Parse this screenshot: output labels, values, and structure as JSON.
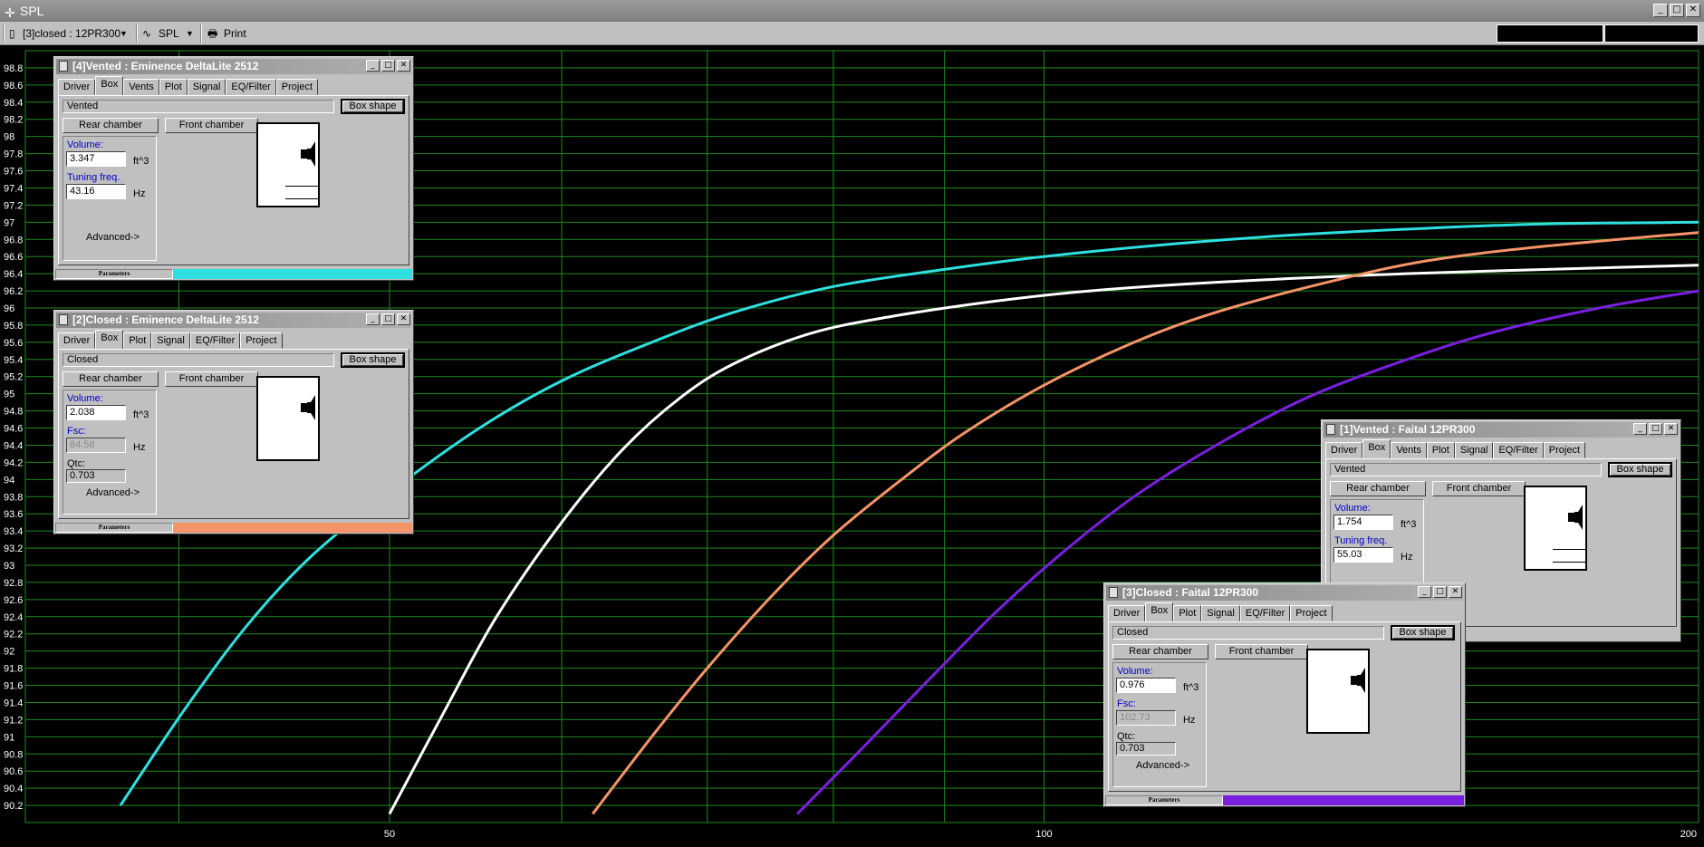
{
  "window": {
    "title": "SPL"
  },
  "toolbar": {
    "project_select": "[3]closed : 12PR300",
    "graph_select": "SPL",
    "print_label": "Print"
  },
  "colors": {
    "trace1": "#f59468",
    "trace2": "#ffffff",
    "trace3": "#7a1fe0",
    "trace4": "#30e0e0",
    "grid": "#1f8a1f"
  },
  "chart_data": {
    "type": "line",
    "title": "",
    "xlabel": "",
    "ylabel": "",
    "xscale": "log",
    "xlim": [
      34,
      200
    ],
    "ylim": [
      90.0,
      99.0
    ],
    "xticks": [
      "50",
      "100",
      "200"
    ],
    "yticks": [
      "98.8",
      "98.6",
      "98.4",
      "98.2",
      "98",
      "97.8",
      "97.6",
      "97.4",
      "97.2",
      "97",
      "96.8",
      "96.6",
      "96.4",
      "96.2",
      "96",
      "95.8",
      "95.6",
      "95.4",
      "95.2",
      "95",
      "94.8",
      "94.6",
      "94.4",
      "94.2",
      "94",
      "93.8",
      "93.6",
      "93.4",
      "93.2",
      "93",
      "92.8",
      "92.6",
      "92.4",
      "92.2",
      "92",
      "91.8",
      "91.6",
      "91.4",
      "91.2",
      "91",
      "90.8",
      "90.6",
      "90.4",
      "90.2"
    ],
    "grid": true,
    "series": [
      {
        "color": "#30e0e0",
        "x": [
          37.6,
          40.2,
          43,
          46,
          50,
          55,
          60,
          66,
          72,
          80,
          90,
          100,
          115,
          130,
          150,
          170,
          200
        ],
        "y": [
          90.2,
          91.3,
          92.3,
          93.1,
          93.85,
          94.6,
          95.15,
          95.6,
          95.95,
          96.25,
          96.45,
          96.6,
          96.75,
          96.85,
          96.93,
          96.98,
          97.0
        ]
      },
      {
        "color": "#ffffff",
        "x": [
          50,
          53,
          56,
          60,
          64,
          68,
          72,
          78,
          85,
          95,
          105,
          120,
          140,
          160,
          200
        ],
        "y": [
          90.1,
          91.3,
          92.4,
          93.5,
          94.35,
          94.95,
          95.35,
          95.7,
          95.9,
          96.08,
          96.2,
          96.3,
          96.38,
          96.43,
          96.5
        ]
      },
      {
        "color": "#f59468",
        "x": [
          62,
          66,
          70,
          75,
          80,
          86,
          92,
          100,
          110,
          120,
          135,
          150,
          170,
          200
        ],
        "y": [
          90.1,
          91.0,
          91.8,
          92.65,
          93.35,
          94.0,
          94.55,
          95.1,
          95.6,
          95.95,
          96.3,
          96.55,
          96.72,
          96.88
        ]
      },
      {
        "color": "#7a1fe0",
        "x": [
          77,
          82,
          88,
          95,
          102,
          110,
          120,
          132,
          145,
          160,
          180,
          200
        ],
        "y": [
          90.1,
          90.8,
          91.6,
          92.45,
          93.15,
          93.8,
          94.4,
          94.95,
          95.35,
          95.7,
          96.0,
          96.2
        ]
      }
    ]
  },
  "dialogs": [
    {
      "id": "d4",
      "title": "[4]Vented : Eminence  DeltaLite 2512",
      "tabs": [
        "Driver",
        "Box",
        "Vents",
        "Plot",
        "Signal",
        "EQ/Filter",
        "Project"
      ],
      "active_tab": "Box",
      "box_type": "Vented",
      "box_shape_label": "Box shape",
      "rear_label": "Rear chamber",
      "front_label": "Front chamber",
      "volume_label": "Volume:",
      "volume": "3.347",
      "volume_unit": "ft^3",
      "param2_label": "Tuning freq.",
      "param2": "43.16",
      "param2_unit": "Hz",
      "advanced_label": "Advanced->",
      "status_label": "Parameters",
      "trace_color": "#30e0e0"
    },
    {
      "id": "d2",
      "title": "[2]Closed : Eminence  DeltaLite 2512",
      "tabs": [
        "Driver",
        "Box",
        "Plot",
        "Signal",
        "EQ/Filter",
        "Project"
      ],
      "active_tab": "Box",
      "box_type": "Closed",
      "box_shape_label": "Box shape",
      "rear_label": "Rear chamber",
      "front_label": "Front chamber",
      "volume_label": "Volume:",
      "volume": "2.038",
      "volume_unit": "ft^3",
      "param2_label": "Fsc:",
      "param2": "84.58",
      "param2_unit": "Hz",
      "qtc_label": "Qtc:",
      "qtc": "0.703",
      "advanced_label": "Advanced->",
      "status_label": "Parameters",
      "trace_color": "#f59468"
    },
    {
      "id": "d1",
      "title": "[1]Vented : Faital  12PR300",
      "tabs": [
        "Driver",
        "Box",
        "Vents",
        "Plot",
        "Signal",
        "EQ/Filter",
        "Project"
      ],
      "active_tab": "Box",
      "box_type": "Vented",
      "box_shape_label": "Box shape",
      "rear_label": "Rear chamber",
      "front_label": "Front chamber",
      "volume_label": "Volume:",
      "volume": "1.754",
      "volume_unit": "ft^3",
      "param2_label": "Tuning freq.",
      "param2": "55.03",
      "param2_unit": "Hz"
    },
    {
      "id": "d3",
      "title": "[3]Closed : Faital  12PR300",
      "tabs": [
        "Driver",
        "Box",
        "Plot",
        "Signal",
        "EQ/Filter",
        "Project"
      ],
      "active_tab": "Box",
      "box_type": "Closed",
      "box_shape_label": "Box shape",
      "rear_label": "Rear chamber",
      "front_label": "Front chamber",
      "volume_label": "Volume:",
      "volume": "0.976",
      "volume_unit": "ft^3",
      "param2_label": "Fsc:",
      "param2": "102.73",
      "param2_unit": "Hz",
      "qtc_label": "Qtc:",
      "qtc": "0.703",
      "advanced_label": "Advanced->",
      "status_label": "Parameters",
      "trace_color": "#7a1fe0"
    }
  ]
}
